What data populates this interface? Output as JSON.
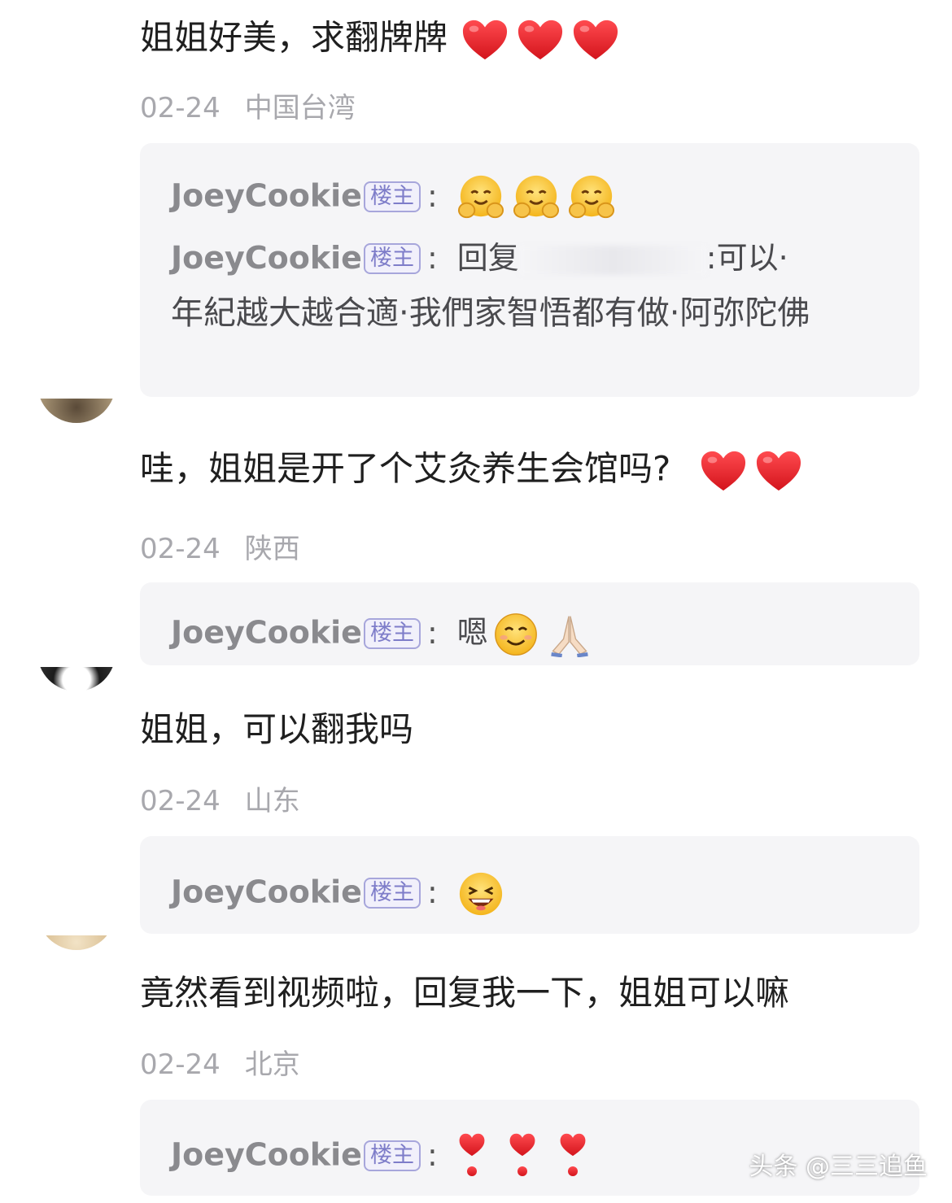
{
  "comments": [
    {
      "text": "姐姐好美，求翻牌牌",
      "date": "02-24",
      "location": "中国台湾",
      "replies": [
        {
          "name": "JoeyCookie",
          "badge": "楼主",
          "colon": ":",
          "text": ""
        },
        {
          "name": "JoeyCookie",
          "badge": "楼主",
          "colon": ":",
          "text_start": "回复",
          "text_after_blur": ":可以·",
          "text_rest": "年紀越大越合適·我們家智悟都有做·阿弥陀佛"
        }
      ]
    },
    {
      "text": "哇，姐姐是开了个艾灸养生会馆吗?",
      "date": "02-24",
      "location": "陕西",
      "replies": [
        {
          "name": "JoeyCookie",
          "badge": "楼主",
          "colon": ":",
          "text": "嗯"
        }
      ]
    },
    {
      "text": "姐姐，可以翻我吗",
      "date": "02-24",
      "location": "山东",
      "replies": [
        {
          "name": "JoeyCookie",
          "badge": "楼主",
          "colon": ":",
          "text": ""
        }
      ]
    },
    {
      "text": "竟然看到视频啦，回复我一下，姐姐可以嘛",
      "date": "02-24",
      "location": "北京",
      "replies": [
        {
          "name": "JoeyCookie",
          "badge": "楼主",
          "colon": ":",
          "text": ""
        }
      ]
    }
  ],
  "icons": {
    "heart": "red-heart-icon",
    "hug": "hugging-face-icon",
    "smile": "smiling-face-icon",
    "pray": "folded-hands-icon",
    "grin": "grinning-face-icon",
    "exclaim_heart": "heart-exclamation-icon"
  },
  "colors": {
    "heart": "#e0242b",
    "badge": "#7e7dc9",
    "reply_bg": "#f5f5f7",
    "meta": "#a8a8ad"
  },
  "watermark": "头条 @三三追鱼"
}
